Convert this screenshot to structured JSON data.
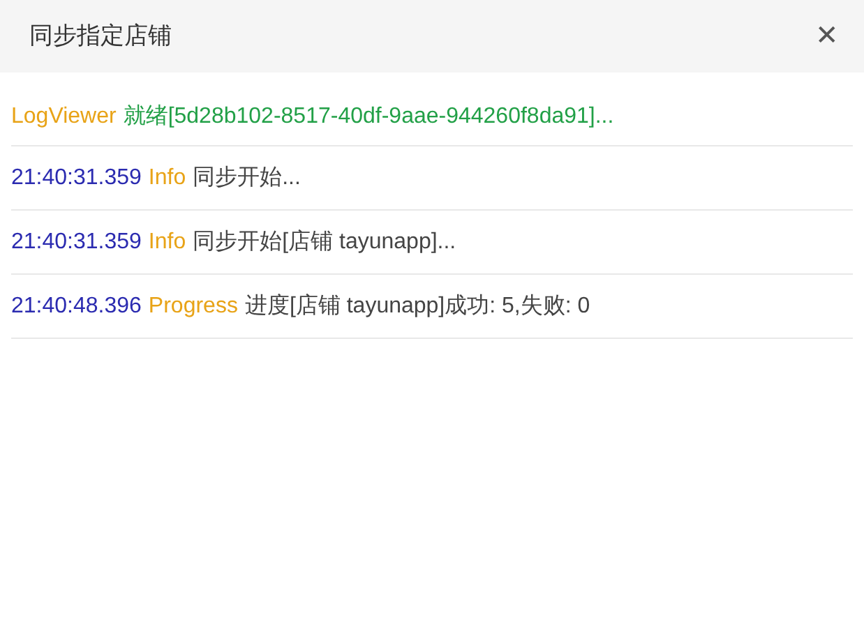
{
  "dialog": {
    "title": "同步指定店铺",
    "close": "✕"
  },
  "log": [
    {
      "parts": [
        {
          "kind": "source",
          "text": "LogViewer"
        },
        {
          "kind": "status",
          "text": "就绪[5d28b102-8517-40df-9aae-944260f8da91]..."
        }
      ]
    },
    {
      "parts": [
        {
          "kind": "time",
          "text": "21:40:31.359"
        },
        {
          "kind": "level",
          "text": "Info"
        },
        {
          "kind": "message",
          "text": "同步开始..."
        }
      ]
    },
    {
      "parts": [
        {
          "kind": "time",
          "text": "21:40:31.359"
        },
        {
          "kind": "level",
          "text": "Info"
        },
        {
          "kind": "message",
          "text": "同步开始[店铺 tayunapp]..."
        }
      ]
    },
    {
      "parts": [
        {
          "kind": "time",
          "text": "21:40:48.396"
        },
        {
          "kind": "level",
          "text": "Progress"
        },
        {
          "kind": "message",
          "text": "进度[店铺 tayunapp]成功: 5,失败: 0"
        }
      ]
    }
  ]
}
